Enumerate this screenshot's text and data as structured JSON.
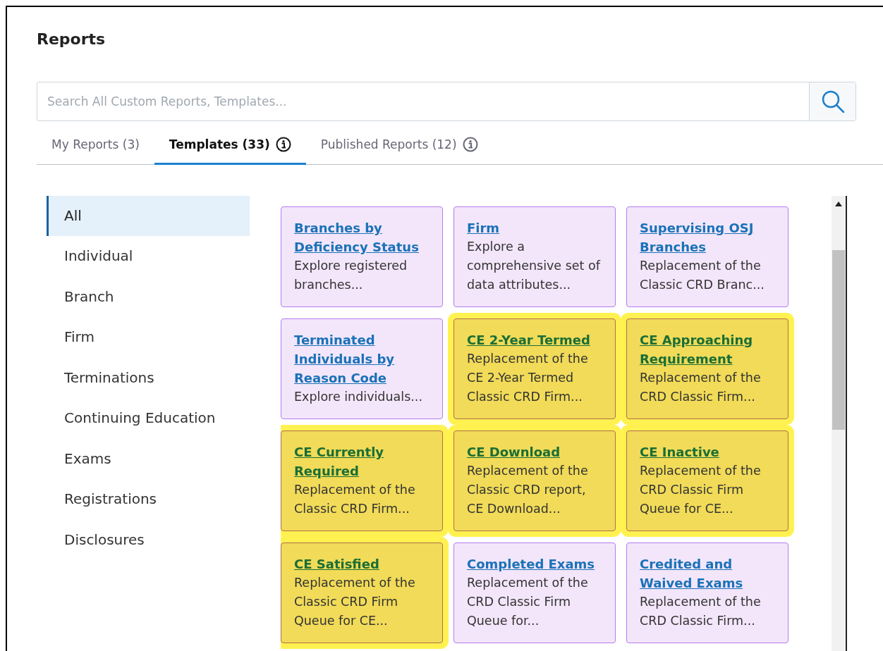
{
  "title": "Reports",
  "search": {
    "placeholder": "Search All Custom Reports, Templates..."
  },
  "tabs": [
    {
      "label": "My Reports (3)",
      "selected": false,
      "info": false
    },
    {
      "label": "Templates (33)",
      "selected": true,
      "info": true
    },
    {
      "label": "Published Reports (12)",
      "selected": false,
      "info": true
    }
  ],
  "sidebar": {
    "items": [
      {
        "label": "All",
        "selected": true
      },
      {
        "label": "Individual",
        "selected": false
      },
      {
        "label": "Branch",
        "selected": false
      },
      {
        "label": "Firm",
        "selected": false
      },
      {
        "label": "Terminations",
        "selected": false
      },
      {
        "label": "Continuing Education",
        "selected": false
      },
      {
        "label": "Exams",
        "selected": false
      },
      {
        "label": "Registrations",
        "selected": false
      },
      {
        "label": "Disclosures",
        "selected": false
      }
    ]
  },
  "cards": [
    {
      "title": "Branches by Deficiency Status",
      "description": "Explore registered branches...",
      "highlighted": false
    },
    {
      "title": "Firm",
      "description": "Explore a comprehensive set of data attributes...",
      "highlighted": false
    },
    {
      "title": "Supervising OSJ Branches",
      "description": "Replacement of the Classic CRD Branc...",
      "highlighted": false
    },
    {
      "title": "Terminated Individuals by Reason Code",
      "description": "Explore individuals...",
      "highlighted": false
    },
    {
      "title": "CE 2-Year Termed",
      "description": "Replacement of the CE 2-Year Termed Classic CRD Firm...",
      "highlighted": true
    },
    {
      "title": "CE Approaching Requirement",
      "description": "Replacement of the CRD Classic Firm...",
      "highlighted": true
    },
    {
      "title": "CE Currently Required",
      "description": "Replacement of the Classic CRD Firm...",
      "highlighted": true
    },
    {
      "title": "CE Download",
      "description": "Replacement of the Classic CRD report, CE Download...",
      "highlighted": true
    },
    {
      "title": "CE Inactive",
      "description": "Replacement of the CRD Classic Firm Queue for CE...",
      "highlighted": true
    },
    {
      "title": "CE Satisfied",
      "description": "Replacement of the Classic CRD Firm Queue for CE...",
      "highlighted": true
    },
    {
      "title": "Completed Exams",
      "description": "Replacement of the CRD Classic Firm Queue for...",
      "highlighted": false
    },
    {
      "title": "Credited and Waived Exams",
      "description": "Replacement of the CRD Classic Firm...",
      "highlighted": false
    }
  ]
}
